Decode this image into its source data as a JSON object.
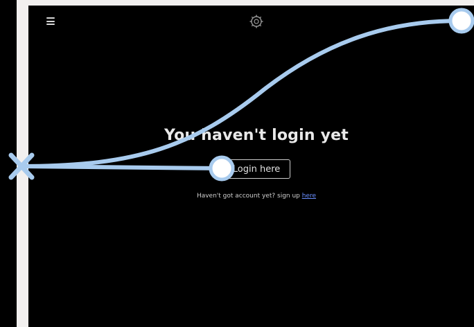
{
  "header": {
    "menu_icon": "hamburger-menu-icon",
    "logo_icon": "app-logo-icon"
  },
  "main": {
    "headline": "You haven't login yet",
    "login_button_label": "Login here",
    "signup_prompt": "Haven't got account yet? sign up",
    "signup_link_label": "here"
  },
  "colors": {
    "background": "#000000",
    "text": "#e9e9e9",
    "link": "#6a8fff",
    "overlay_stroke": "#a8cbee"
  }
}
